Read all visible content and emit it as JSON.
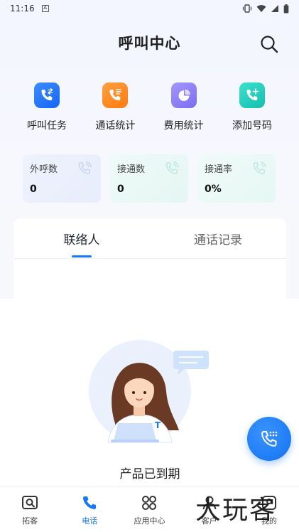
{
  "status_bar": {
    "time": "11:16"
  },
  "header": {
    "title": "呼叫中心"
  },
  "quick_actions": [
    {
      "label": "呼叫任务",
      "icon": "call-task-icon",
      "color": "#1677ff"
    },
    {
      "label": "通话统计",
      "icon": "call-stats-icon",
      "color": "#ff8a1f"
    },
    {
      "label": "费用统计",
      "icon": "cost-stats-icon",
      "color": "#8a7cf5"
    },
    {
      "label": "添加号码",
      "icon": "add-number-icon",
      "color": "#1cc9b7"
    }
  ],
  "stats": [
    {
      "label": "外呼数",
      "value": "0"
    },
    {
      "label": "接通数",
      "value": "0"
    },
    {
      "label": "接通率",
      "value": "0%"
    }
  ],
  "tabs": [
    {
      "label": "联络人",
      "active": true
    },
    {
      "label": "通话记录",
      "active": false
    }
  ],
  "empty_state": {
    "text": "产品已到期"
  },
  "bottom_nav": [
    {
      "label": "拓客",
      "icon": "search-box-icon",
      "active": false
    },
    {
      "label": "电话",
      "icon": "phone-icon",
      "active": true
    },
    {
      "label": "应用中心",
      "icon": "apps-grid-icon",
      "active": false
    },
    {
      "label": "客户",
      "icon": "customer-icon",
      "active": false
    },
    {
      "label": "我的",
      "icon": "profile-icon",
      "active": false
    }
  ],
  "watermark": {
    "text": "大玩客"
  },
  "colors": {
    "accent": "#1677ff"
  }
}
